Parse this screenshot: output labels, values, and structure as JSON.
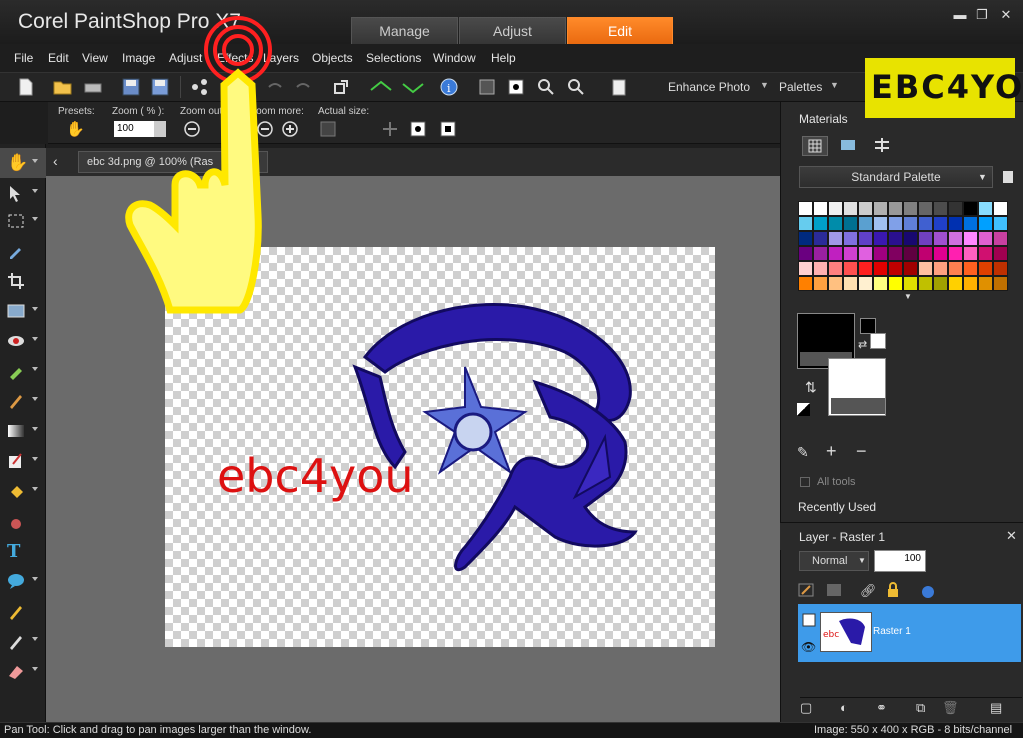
{
  "app": {
    "title": "Corel PaintShop Pro X7"
  },
  "workspace_tabs": [
    {
      "label": "Manage",
      "active": false
    },
    {
      "label": "Adjust",
      "active": false
    },
    {
      "label": "Edit",
      "active": true
    }
  ],
  "menu": [
    "File",
    "Edit",
    "View",
    "Image",
    "Adjust",
    "Effects",
    "Layers",
    "Objects",
    "Selections",
    "Window",
    "Help"
  ],
  "toolbar": {
    "enhance_label": "Enhance Photo",
    "palettes_label": "Palettes"
  },
  "tool_options": {
    "presets_label": "Presets:",
    "zoom_label": "Zoom ( % ):",
    "zoom_value": "100",
    "zoom_out_label": "Zoom out/in:",
    "zoom_more_label": "Zoom more:",
    "actual_size_label": "Actual size:"
  },
  "document": {
    "tab_label": "ebc 3d.png @ 100% (Ras"
  },
  "canvas_content": {
    "logo_text": "ebc4you",
    "logo_color": "#dd1111",
    "emblem_color": "#2a1aa8"
  },
  "materials": {
    "title": "Materials",
    "palette_name": "Standard Palette",
    "all_tools_label": "All tools",
    "recently_used_label": "Recently Used",
    "swatch_colors": [
      "#ffffff",
      "#ffffff",
      "#f0f0f0",
      "#e0e0e0",
      "#cccccc",
      "#b0b0b0",
      "#999999",
      "#808080",
      "#666666",
      "#4d4d4d",
      "#333333",
      "#000000",
      "#88ddff",
      "#ffffff",
      "#66ccee",
      "#00a0c8",
      "#008caa",
      "#007090",
      "#5aa0d0",
      "#a0c0f0",
      "#80a0e8",
      "#6080d8",
      "#4060d0",
      "#2040c8",
      "#0030b0",
      "#0070e0",
      "#00a0ff",
      "#40c0ff",
      "#002a80",
      "#2b2b99",
      "#a098e8",
      "#8070e0",
      "#6040c8",
      "#3a18b0",
      "#2a1090",
      "#180870",
      "#7040c0",
      "#a050d0",
      "#d070e0",
      "#ff88ff",
      "#e060d0",
      "#c840a0",
      "#6a0080",
      "#9a20a0",
      "#c020c0",
      "#d040d0",
      "#e060e0",
      "#a00080",
      "#800060",
      "#600040",
      "#c00070",
      "#e00090",
      "#ff20b0",
      "#ff60c0",
      "#d01070",
      "#a00050",
      "#ffd0d0",
      "#ffb0b0",
      "#ff8080",
      "#ff5050",
      "#ff2020",
      "#e00000",
      "#c00000",
      "#a00000",
      "#ffc0a0",
      "#ffa080",
      "#ff8050",
      "#ff6020",
      "#e04000",
      "#c03000",
      "#ff8000",
      "#ffa040",
      "#ffc080",
      "#ffe0b0",
      "#fff0d0",
      "#ffff80",
      "#ffff00",
      "#e0e000",
      "#c0c000",
      "#a0a000",
      "#ffd000",
      "#ffb000",
      "#e09000",
      "#c07000"
    ]
  },
  "layers": {
    "title": "Layer - Raster 1",
    "blend_mode": "Normal",
    "opacity": "100",
    "layer_name": "Raster 1"
  },
  "status": {
    "left": "Pan Tool: Click and drag to pan images larger than the window.",
    "right": "Image:  550 x 400 x RGB - 8 bits/channel"
  },
  "watermark": {
    "text": "EBC4YOU"
  }
}
